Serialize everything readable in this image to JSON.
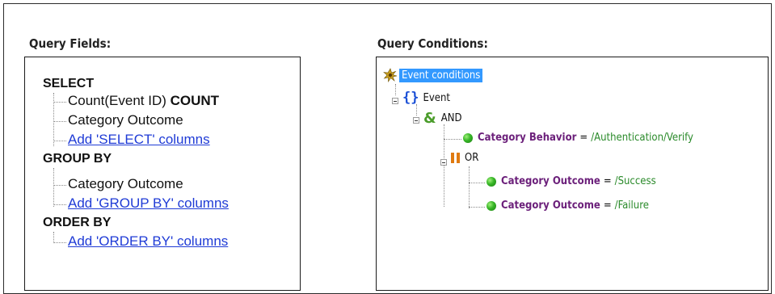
{
  "query_fields": {
    "title": "Query Fields:",
    "select_header": "SELECT",
    "select_items": [
      {
        "text": "Count(Event ID)",
        "suffix": "COUNT"
      },
      {
        "text": "Category Outcome",
        "suffix": ""
      }
    ],
    "select_add_link": "Add 'SELECT' columns",
    "group_header": "GROUP BY",
    "group_items": [
      "Category Outcome"
    ],
    "group_add_link": "Add 'GROUP BY' columns",
    "order_header": "ORDER BY",
    "order_add_link": "Add 'ORDER BY' columns"
  },
  "query_conditions": {
    "title": "Query Conditions:",
    "root_label": "Event conditions",
    "event_label": "Event",
    "and_label": "AND",
    "or_label": "OR",
    "conditions": [
      {
        "field": "Category Behavior",
        "operator": "=",
        "value": "/Authentication/Verify"
      },
      {
        "field": "Category Outcome",
        "operator": "=",
        "value": "/Success"
      },
      {
        "field": "Category Outcome",
        "operator": "=",
        "value": "/Failure"
      }
    ]
  },
  "colors": {
    "link": "#1f3bd6",
    "field": "#6b1f7a",
    "value": "#2a8a2a",
    "selection": "#3399ff",
    "and_icon": "#4a9c2a",
    "or_icon": "#e07a10",
    "braces_icon": "#1a4fd6"
  },
  "icons": {
    "root": "gear-sparkle-icon",
    "event": "curly-braces-icon",
    "and": "ampersand-icon",
    "or": "pause-bars-icon",
    "condition": "green-dot-icon",
    "expander": "collapse-minus-icon"
  }
}
